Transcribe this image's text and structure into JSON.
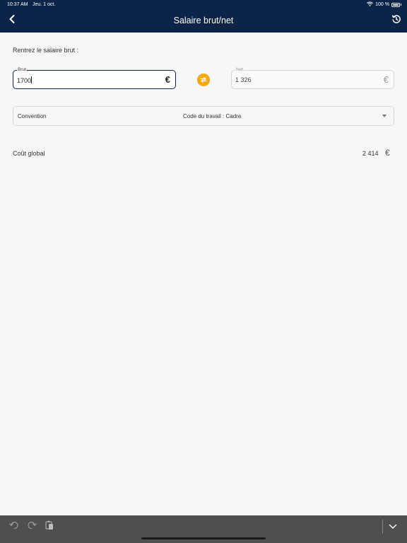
{
  "status_bar": {
    "time": "10:37 AM",
    "date": "Jeu. 1 oct.",
    "battery": "100 %"
  },
  "nav": {
    "title": "Salaire brut/net",
    "back_icon": "chevron-left-icon",
    "history_icon": "history-icon"
  },
  "form": {
    "prompt": "Rentrez le salaire brut :",
    "brut": {
      "label": "Brut",
      "value": "1700",
      "currency": "€"
    },
    "net": {
      "label": "Net",
      "value": "1 326",
      "currency": "€"
    },
    "swap_icon": "swap-arrows-icon",
    "swap_color": "#f4a816"
  },
  "convention": {
    "label": "Convention",
    "value": "Code du travail : Cadre"
  },
  "cout_global": {
    "label": "Coût global",
    "value": "2 414",
    "currency": "€"
  },
  "colors": {
    "header_bg": "#0c2447",
    "page_bg": "#f7f7f7",
    "keyboard_bar_bg": "#4f4f4f"
  },
  "keyboard_bar": {
    "icons": [
      "undo-icon",
      "redo-icon",
      "paste-icon",
      "dismiss-keyboard-icon"
    ]
  }
}
